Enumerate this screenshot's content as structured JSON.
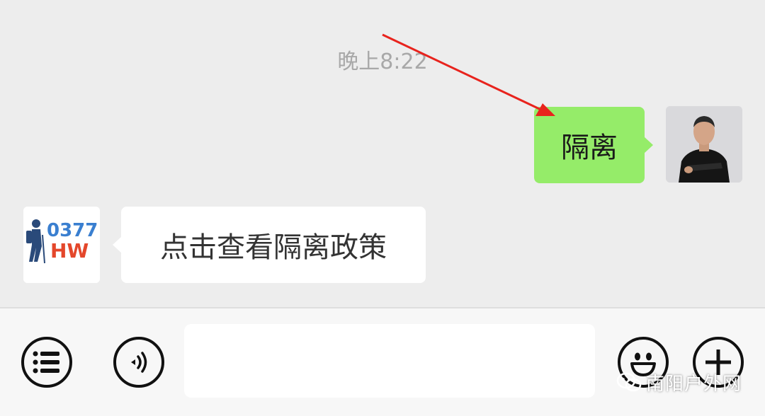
{
  "chat": {
    "timestamp": "晚上8:22",
    "messages": [
      {
        "side": "right",
        "text": "隔离"
      },
      {
        "side": "left",
        "text": "点击查看隔离政策"
      }
    ],
    "left_avatar": {
      "logo_number": "0377",
      "logo_letters": "HW"
    }
  },
  "input_bar": {
    "menu_icon": "list-icon",
    "voice_icon": "voice-icon",
    "text_value": "",
    "emoji_icon": "smiley-icon",
    "plus_icon": "plus-icon"
  },
  "watermark": {
    "text": "南阳户外网"
  },
  "colors": {
    "background": "#ededed",
    "sent_bubble": "#95ec69",
    "received_bubble": "#ffffff",
    "annotation_arrow": "#e8231d"
  }
}
